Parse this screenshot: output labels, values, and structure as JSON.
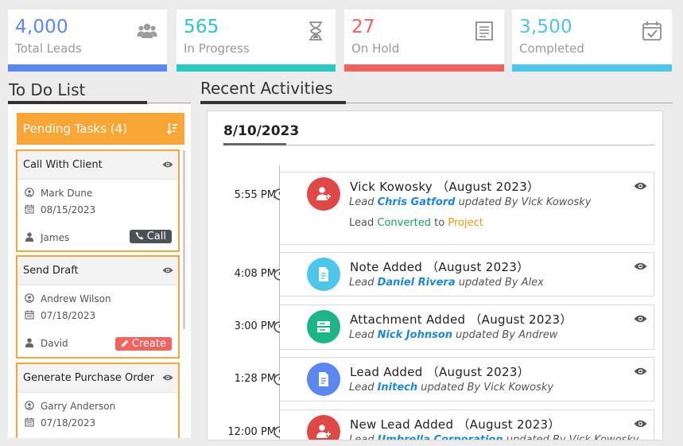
{
  "stats": [
    {
      "value": "4,000",
      "label": "Total Leads",
      "color": "#5b87f2",
      "icon": "users-icon"
    },
    {
      "value": "565",
      "label": "In Progress",
      "color": "#28c9c3",
      "icon": "hourglass-icon"
    },
    {
      "value": "27",
      "label": "On Hold",
      "color": "#f4625f",
      "icon": "list-icon"
    },
    {
      "value": "3,500",
      "label": "Completed",
      "color": "#4cc6ea",
      "icon": "calendar-check-icon"
    }
  ],
  "todo": {
    "title": "To Do List",
    "pending_label": "Pending Tasks (4)",
    "tasks": [
      {
        "title": "Call With Client",
        "contact": "Mark Dune",
        "date": "08/15/2023",
        "owner": "James",
        "action": "Call",
        "action_color": "#4d5156"
      },
      {
        "title": "Send Draft",
        "contact": "Andrew Wilson",
        "date": "07/18/2023",
        "owner": "David",
        "action": "Create",
        "action_color": "#f4625f"
      },
      {
        "title": "Generate Purchase Order",
        "contact": "Garry Anderson",
        "date": "07/18/2023"
      }
    ]
  },
  "activities": {
    "title": "Recent Activities",
    "date": "8/10/2023",
    "items": [
      {
        "time": "5:55 PM",
        "title": "Vick Kowosky （August 2023）",
        "lead_prefix": "Lead ",
        "lead_name": "Chris Gatford",
        "lead_suffix": " updated By Vick Kowosky",
        "conv_prefix": "Lead ",
        "conv_from": "Converted",
        "conv_mid": " to ",
        "conv_to": "Project",
        "avatar_color": "#e04848",
        "avatar_icon": "add-user-icon"
      },
      {
        "time": "4:08 PM",
        "title": "Note Added （August 2023）",
        "lead_prefix": "Lead ",
        "lead_name": "Daniel Rivera",
        "lead_suffix": " updated By Alex",
        "avatar_color": "#4cc6ea",
        "avatar_icon": "document-icon"
      },
      {
        "time": "3:00 PM",
        "title": "Attachment Added （August 2023）",
        "lead_prefix": "Lead ",
        "lead_name": "Nick Johnson",
        "lead_suffix": " updated By Andrew",
        "avatar_color": "#1cb586",
        "avatar_icon": "server-icon"
      },
      {
        "time": "1:28 PM",
        "title": "Lead Added （August 2023）",
        "lead_prefix": "Lead ",
        "lead_name": "Initech",
        "lead_suffix": " updated By Vick Kowosky",
        "avatar_color": "#5b87f2",
        "avatar_icon": "document-icon"
      },
      {
        "time": "12:00 PM",
        "title": "New Lead Added （August 2023）",
        "lead_prefix": "Lead ",
        "lead_name": "Umbrella Corporation",
        "lead_suffix": " updated By Vick Kowosky",
        "avatar_color": "#e04848",
        "avatar_icon": "add-user-icon"
      }
    ]
  }
}
